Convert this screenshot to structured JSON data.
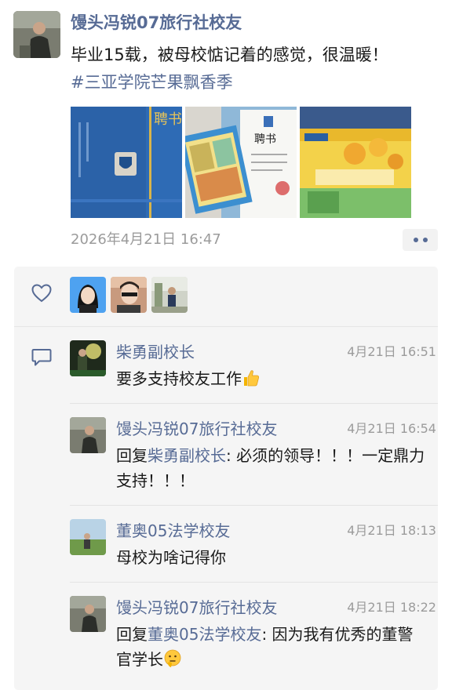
{
  "post": {
    "author": "馒头冯锐07旅行社校友",
    "text": "毕业15载，被母校惦记着的感觉，很温暖！",
    "hashtag": "#三亚学院芒果飘香季",
    "time": "2026年4月21日 16:47",
    "photos": [
      {
        "icon": "certificate-folder-photo",
        "text_top": "聘书"
      },
      {
        "icon": "certificate-and-gift-photo",
        "text_top": "聘书"
      },
      {
        "icon": "mango-gift-box-photo"
      }
    ]
  },
  "likes": {
    "icon": "heart-icon",
    "avatars": [
      "liker-avatar-cartoon",
      "liker-avatar-woman",
      "liker-avatar-man"
    ]
  },
  "comments_icon": "comment-bubble-icon",
  "comments": [
    {
      "author": "柴勇副校长",
      "time": "4月21日 16:51",
      "text": "要多支持校友工作",
      "emoji": "thumbs-up-icon"
    },
    {
      "author": "馒头冯锐07旅行社校友",
      "time": "4月21日 16:54",
      "reply_prefix": "回复",
      "reply_to": "柴勇副校长",
      "text": ": 必须的领导！！！一定鼎力支持！！！"
    },
    {
      "author": "董奥05法学校友",
      "time": "4月21日 18:13",
      "text": "母校为啥记得你"
    },
    {
      "author": "馒头冯锐07旅行社校友",
      "time": "4月21日 18:22",
      "reply_prefix": "回复",
      "reply_to": "董奥05法学校友",
      "text": ": 因为我有优秀的董警官学长",
      "emoji": "thinking-face-icon"
    }
  ],
  "colors": {
    "link": "#576b95",
    "panel": "#f5f5f5",
    "time": "#9b9b9b"
  }
}
